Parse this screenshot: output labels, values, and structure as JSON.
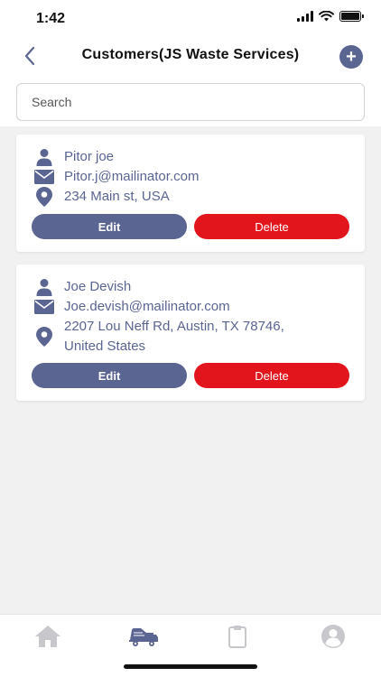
{
  "status_bar": {
    "time": "1:42"
  },
  "nav": {
    "title": "Customers(JS Waste Services)",
    "add_symbol": "+"
  },
  "search": {
    "placeholder": "Search",
    "value": ""
  },
  "customers": [
    {
      "name": "Pitor joe",
      "email": "Pitor.j@mailinator.com",
      "address_lines": [
        "234 Main st, USA"
      ],
      "edit_label": "Edit",
      "delete_label": "Delete"
    },
    {
      "name": "Joe Devish",
      "email": "Joe.devish@mailinator.com",
      "address_lines": [
        "2207 Lou Neff Rd, Austin, TX 78746,",
        "United States"
      ],
      "edit_label": "Edit",
      "delete_label": "Delete"
    }
  ],
  "tabs": [
    {
      "icon": "home-icon"
    },
    {
      "icon": "garbage-truck-icon",
      "active": true
    },
    {
      "icon": "clipboard-icon"
    },
    {
      "icon": "profile-icon"
    }
  ],
  "colors": {
    "accent": "#5b6592",
    "danger": "#e2141c",
    "background": "#f1f1f2",
    "tab_inactive": "#c8c8cc"
  }
}
